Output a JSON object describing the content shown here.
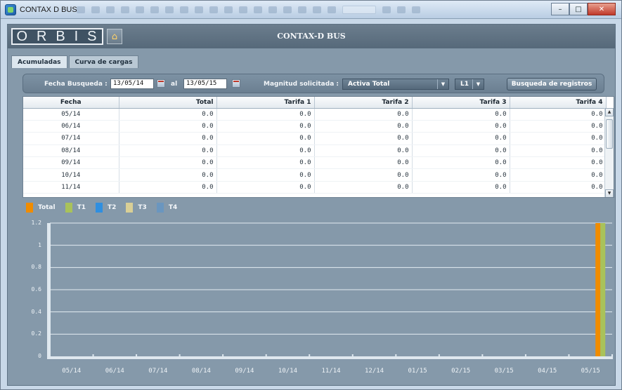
{
  "window": {
    "title": "CONTAX D BUS",
    "minimize": "–",
    "maximize": "□",
    "close": "✕"
  },
  "header": {
    "logo_letters": [
      "O",
      "R",
      "B",
      "I",
      "S"
    ],
    "app_title": "CONTAX-D BUS",
    "home_icon": "house-icon"
  },
  "tabs": [
    {
      "label": "Acumuladas",
      "active": true
    },
    {
      "label": "Curva de cargas",
      "active": false
    }
  ],
  "filters": {
    "fecha_label": "Fecha Busqueda :",
    "date_from": "13/05/14",
    "al_label": "al",
    "date_to": "13/05/15",
    "magnitud_label": "Magnitud solicitada :",
    "magnitud_value": "Activa Total",
    "line_value": "L1",
    "search_button": "Busqueda de registros"
  },
  "table": {
    "headers": [
      "Fecha",
      "Total",
      "Tarifa 1",
      "Tarifa 2",
      "Tarifa 3",
      "Tarifa 4"
    ],
    "rows": [
      [
        "05/14",
        "0.0",
        "0.0",
        "0.0",
        "0.0",
        "0.0"
      ],
      [
        "06/14",
        "0.0",
        "0.0",
        "0.0",
        "0.0",
        "0.0"
      ],
      [
        "07/14",
        "0.0",
        "0.0",
        "0.0",
        "0.0",
        "0.0"
      ],
      [
        "08/14",
        "0.0",
        "0.0",
        "0.0",
        "0.0",
        "0.0"
      ],
      [
        "09/14",
        "0.0",
        "0.0",
        "0.0",
        "0.0",
        "0.0"
      ],
      [
        "10/14",
        "0.0",
        "0.0",
        "0.0",
        "0.0",
        "0.0"
      ],
      [
        "11/14",
        "0.0",
        "0.0",
        "0.0",
        "0.0",
        "0.0"
      ]
    ]
  },
  "legend": [
    {
      "name": "Total",
      "color": "#f08c00"
    },
    {
      "name": "T1",
      "color": "#a9c25a"
    },
    {
      "name": "T2",
      "color": "#2f8fe0"
    },
    {
      "name": "T3",
      "color": "#d9cf96"
    },
    {
      "name": "T4",
      "color": "#6a96bf"
    }
  ],
  "chart_data": {
    "type": "bar",
    "categories": [
      "05/14",
      "06/14",
      "07/14",
      "08/14",
      "09/14",
      "10/14",
      "11/14",
      "12/14",
      "01/15",
      "02/15",
      "03/15",
      "04/15",
      "05/15"
    ],
    "series": [
      {
        "name": "Total",
        "values": [
          0,
          0,
          0,
          0,
          0,
          0,
          0,
          0,
          0,
          0,
          0,
          0,
          1.2
        ]
      },
      {
        "name": "T1",
        "values": [
          0,
          0,
          0,
          0,
          0,
          0,
          0,
          0,
          0,
          0,
          0,
          0,
          1.2
        ]
      },
      {
        "name": "T2",
        "values": [
          0,
          0,
          0,
          0,
          0,
          0,
          0,
          0,
          0,
          0,
          0,
          0,
          0
        ]
      },
      {
        "name": "T3",
        "values": [
          0,
          0,
          0,
          0,
          0,
          0,
          0,
          0,
          0,
          0,
          0,
          0,
          0
        ]
      },
      {
        "name": "T4",
        "values": [
          0,
          0,
          0,
          0,
          0,
          0,
          0,
          0,
          0,
          0,
          0,
          0,
          0
        ]
      }
    ],
    "yticks": [
      "0",
      "0.2",
      "0.4",
      "0.6",
      "0.8",
      "1",
      "1.2"
    ],
    "ylim": [
      0,
      1.2
    ],
    "grid": true,
    "legend_position": "top-left"
  }
}
